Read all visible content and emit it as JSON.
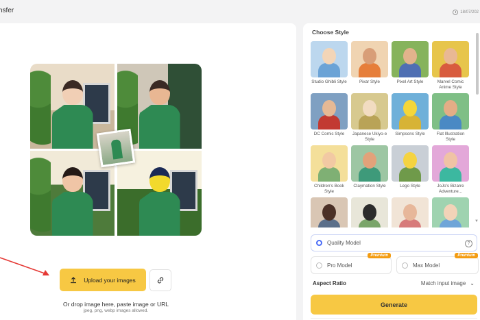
{
  "header": {
    "title": "nsfer",
    "date": "18/07/202"
  },
  "upload": {
    "button_label": "Upload your images",
    "drop_hint": "Or drop image here, paste image or URL",
    "formats_hint": "jpeg, png, webp images allowed."
  },
  "styles": {
    "title": "Choose Style",
    "items": [
      {
        "label": "Studio Ghibli Style",
        "bg": "#bcd7ee",
        "face": "#f3d5b7",
        "torso": "#6ba3d6"
      },
      {
        "label": "Pixar Style",
        "bg": "#f0d4b2",
        "face": "#d89e78",
        "torso": "#e67e3a"
      },
      {
        "label": "Pixel Art Style",
        "bg": "#86b35c",
        "face": "#e2b38c",
        "torso": "#4f6fb3"
      },
      {
        "label": "Marvel Comic Anime Style",
        "bg": "#e7c54b",
        "face": "#e9b894",
        "torso": "#d85b3e"
      },
      {
        "label": "DC Comic Style",
        "bg": "#7fa0c2",
        "face": "#e6b995",
        "torso": "#c23a32"
      },
      {
        "label": "Japanese Ukiyo-e Style",
        "bg": "#d7c98f",
        "face": "#f2dcc1",
        "torso": "#b9a357"
      },
      {
        "label": "Simpsons Style",
        "bg": "#6fb0d9",
        "face": "#f4d63a",
        "torso": "#d7b336"
      },
      {
        "label": "Flat Illustration Style",
        "bg": "#7fbf86",
        "face": "#e4ad86",
        "torso": "#4a89c4"
      },
      {
        "label": "Children's Book Style",
        "bg": "#f4df9a",
        "face": "#f2c9a3",
        "torso": "#7fb074"
      },
      {
        "label": "Claymation Style",
        "bg": "#9dc6a3",
        "face": "#e2a27a",
        "torso": "#3e9a7a"
      },
      {
        "label": "Lego Style",
        "bg": "#c9cfd6",
        "face": "#f5d341",
        "torso": "#6f9a4a"
      },
      {
        "label": "JoJo's Bizarre Adventure...",
        "bg": "#e3a8d9",
        "face": "#f0c3a5",
        "torso": "#3cb8a0"
      },
      {
        "label": "",
        "bg": "#d9c6b4",
        "face": "#4b3026",
        "torso": "#5b6f8a"
      },
      {
        "label": "",
        "bg": "#e8e6d9",
        "face": "#2c2c2c",
        "torso": "#7aa56a"
      },
      {
        "label": "",
        "bg": "#f1e4d6",
        "face": "#e7b79a",
        "torso": "#d77b7b"
      },
      {
        "label": "",
        "bg": "#9fd3b0",
        "face": "#f2d3b8",
        "torso": "#6fa5d8"
      }
    ]
  },
  "models": {
    "quality": {
      "label": "Quality Model",
      "selected": true
    },
    "pro": {
      "label": "Pro Model",
      "badge": "Premium"
    },
    "max": {
      "label": "Max Model",
      "badge": "Premium"
    }
  },
  "aspect": {
    "label": "Aspect Ratio",
    "value": "Match input image"
  },
  "generate": {
    "label": "Generate"
  }
}
